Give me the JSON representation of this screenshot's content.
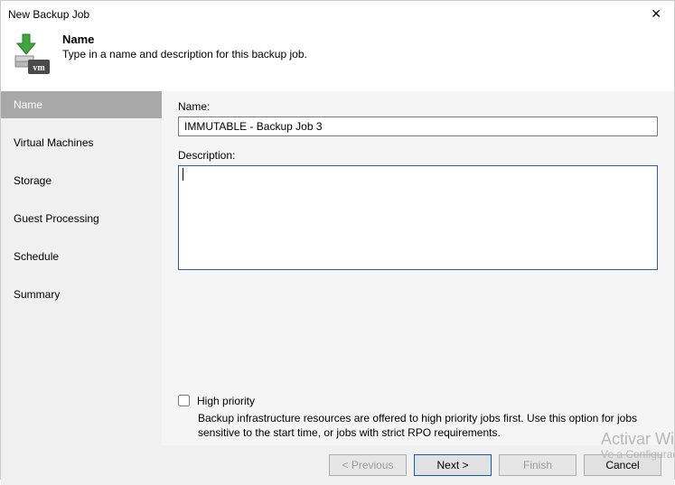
{
  "window": {
    "title": "New Backup Job",
    "close_glyph": "✕"
  },
  "header": {
    "title": "Name",
    "subtitle": "Type in a name and description for this backup job."
  },
  "sidebar": {
    "steps": [
      {
        "label": "Name",
        "active": true
      },
      {
        "label": "Virtual Machines",
        "active": false
      },
      {
        "label": "Storage",
        "active": false
      },
      {
        "label": "Guest Processing",
        "active": false
      },
      {
        "label": "Schedule",
        "active": false
      },
      {
        "label": "Summary",
        "active": false
      }
    ]
  },
  "form": {
    "name_label": "Name:",
    "name_value": "IMMUTABLE - Backup Job 3",
    "desc_label": "Description:",
    "desc_value": "",
    "priority_label": "High priority",
    "priority_checked": false,
    "priority_hint": "Backup infrastructure resources are offered to high priority jobs first. Use this option for jobs sensitive to the start time, or jobs with strict RPO requirements."
  },
  "footer": {
    "previous": "< Previous",
    "next": "Next >",
    "finish": "Finish",
    "cancel": "Cancel"
  },
  "watermark": {
    "line1": "Activar Win",
    "line2": "Ve a Configurac"
  },
  "icons": {
    "close": "close-icon",
    "logo": "vm-backup-icon"
  }
}
